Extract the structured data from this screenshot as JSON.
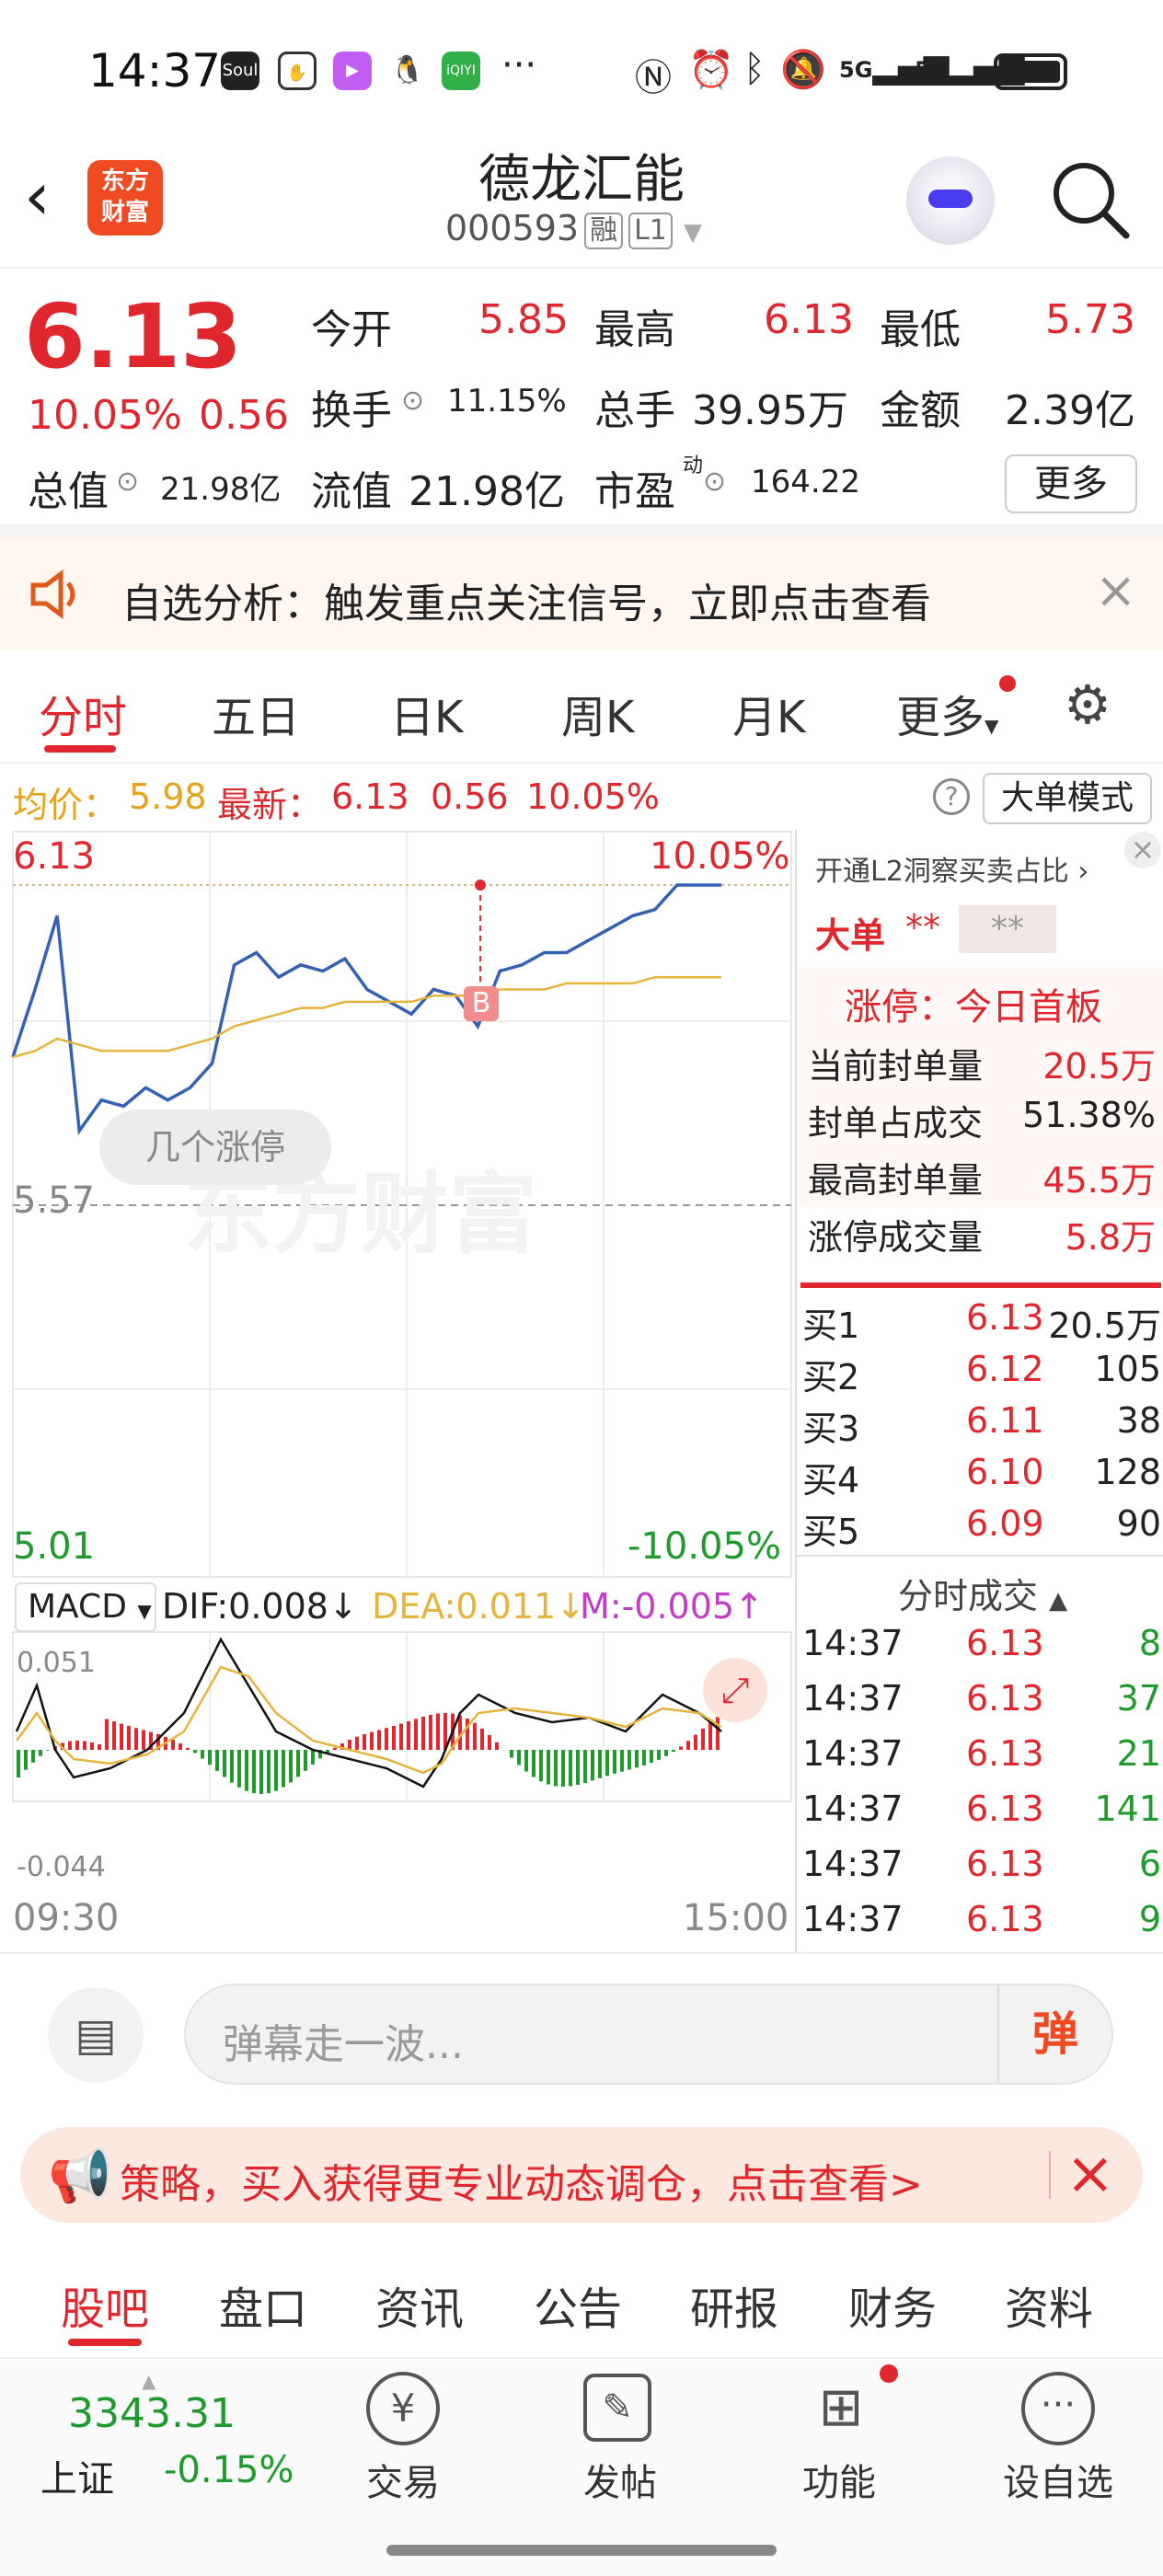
{
  "status": {
    "time": "14:37",
    "app_icons": [
      "Soul",
      "iQIYI"
    ],
    "dots": "···",
    "net1": "5G",
    "net2": "5G"
  },
  "header": {
    "title": "德龙汇能",
    "code": "000593",
    "tag1": "融",
    "tag2": "L1",
    "logo_line1": "东方",
    "logo_line2": "财富"
  },
  "quote": {
    "price": "6.13",
    "pct": "10.05%",
    "chg": "0.56",
    "open_label": "今开",
    "open": "5.85",
    "high_label": "最高",
    "high": "6.13",
    "low_label": "最低",
    "low": "5.73",
    "turnover_label": "换手",
    "turnover": "11.15%",
    "vol_label": "总手",
    "vol": "39.95万",
    "amount_label": "金额",
    "amount": "2.39亿",
    "mktcap_label": "总值",
    "mktcap": "21.98亿",
    "float_label": "流值",
    "float": "21.98亿",
    "pe_label": "市盈",
    "pe_sup": "动",
    "pe": "164.22",
    "more": "更多"
  },
  "alert": {
    "text": "自选分析：触发重点关注信号，立即点击查看"
  },
  "chart_tabs": [
    "分时",
    "五日",
    "日K",
    "周K",
    "月K",
    "更多"
  ],
  "info": {
    "avg_label": "均价：",
    "avg": "5.98",
    "last_label": "最新：",
    "last": "6.13",
    "chg": "0.56",
    "pct": "10.05%",
    "mode_btn": "大单模式"
  },
  "chart": {
    "y_top": "6.13",
    "y_mid": "5.57",
    "y_bot": "5.01",
    "pct_top": "10.05%",
    "pct_bot": "-10.05%",
    "watermark": "东方财富",
    "pill": "几个涨停",
    "marker": "B",
    "x_start": "09:30",
    "x_end": "15:00"
  },
  "macd": {
    "label": "MACD",
    "dif": "DIF:0.008",
    "dea": "DEA:0.011",
    "m": "M:-0.005",
    "top": "0.051",
    "bot": "-0.044"
  },
  "chart_data": {
    "type": "line",
    "title": "",
    "ylim": [
      5.01,
      6.13
    ],
    "x_labels": [
      "09:30",
      "15:00"
    ],
    "series": [
      {
        "values": [
          5.85,
          5.96,
          6.08,
          5.73,
          5.78,
          5.77,
          5.8,
          5.78,
          5.8,
          5.84,
          6.0,
          6.02,
          5.98,
          6.0,
          5.99,
          6.01,
          5.96,
          5.94,
          5.92,
          5.96,
          5.95,
          5.9,
          5.99,
          6.0,
          6.02,
          6.02,
          6.04,
          6.06,
          6.08,
          6.09,
          6.13,
          6.13,
          6.13
        ]
      },
      {
        "values": [
          5.85,
          5.86,
          5.88,
          5.87,
          5.86,
          5.86,
          5.86,
          5.86,
          5.87,
          5.88,
          5.9,
          5.91,
          5.92,
          5.93,
          5.93,
          5.94,
          5.94,
          5.94,
          5.94,
          5.95,
          5.95,
          5.95,
          5.96,
          5.96,
          5.96,
          5.97,
          5.97,
          5.97,
          5.97,
          5.98,
          5.98,
          5.98,
          5.98
        ]
      }
    ]
  },
  "rpanel": {
    "l2_link": "开通L2洞察买卖占比",
    "big_label": "大单",
    "big_v1": "**",
    "big_v2": "**",
    "limit_title": "涨停：今日首板",
    "rows": [
      {
        "k": "当前封单量",
        "v": "20.5万"
      },
      {
        "k": "封单占成交",
        "v": "51.38%"
      },
      {
        "k": "最高封单量",
        "v": "45.5万"
      },
      {
        "k": "涨停成交量",
        "v": "5.8万"
      }
    ],
    "bids": [
      {
        "k": "买1",
        "p": "6.13",
        "v": "20.5万"
      },
      {
        "k": "买2",
        "p": "6.12",
        "v": "105"
      },
      {
        "k": "买3",
        "p": "6.11",
        "v": "38"
      },
      {
        "k": "买4",
        "p": "6.10",
        "v": "128"
      },
      {
        "k": "买5",
        "p": "6.09",
        "v": "90"
      }
    ],
    "ticks_title": "分时成交",
    "ticks": [
      {
        "t": "14:37",
        "p": "6.13",
        "v": "8"
      },
      {
        "t": "14:37",
        "p": "6.13",
        "v": "37"
      },
      {
        "t": "14:37",
        "p": "6.13",
        "v": "21"
      },
      {
        "t": "14:37",
        "p": "6.13",
        "v": "141"
      },
      {
        "t": "14:37",
        "p": "6.13",
        "v": "6"
      },
      {
        "t": "14:37",
        "p": "6.13",
        "v": "9"
      }
    ]
  },
  "comment": {
    "placeholder": "弹幕走一波...",
    "danmu": "弹"
  },
  "ad": {
    "text": "策略，买入获得更专业动态调仓，点击查看>"
  },
  "bottom_tabs": [
    "股吧",
    "盘口",
    "资讯",
    "公告",
    "研报",
    "财务",
    "资料"
  ],
  "nav": {
    "index_value": "3343.31",
    "index_name": "上证",
    "index_chg": "-0.15%",
    "items": [
      "交易",
      "发帖",
      "功能",
      "设自选"
    ]
  },
  "colors": {
    "up": "#e0272e",
    "down": "#1f9a2c",
    "price_line": "#3461b3",
    "avg_line": "#e6b43c"
  }
}
